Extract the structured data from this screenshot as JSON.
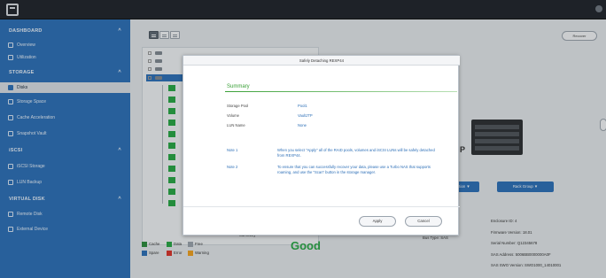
{
  "sidebar": {
    "sections": [
      {
        "label": "DASHBOARD",
        "chev": "^"
      },
      {
        "label": "STORAGE",
        "chev": "^"
      },
      {
        "label": "iSCSI",
        "chev": "^"
      },
      {
        "label": "VIRTUAL DISK",
        "chev": "^"
      }
    ],
    "items": [
      {
        "label": "Overview",
        "icon": "overview-icon"
      },
      {
        "label": "Utilization",
        "icon": "utilization-icon"
      },
      {
        "label": "Disks",
        "icon": "disk-icon"
      },
      {
        "label": "Storage Space",
        "icon": "storage-space-icon"
      },
      {
        "label": "Cache Acceleration",
        "icon": "cache-icon"
      },
      {
        "label": "Snapshot Vault",
        "icon": "snapshot-icon"
      },
      {
        "label": "iSCSI Storage",
        "icon": "iscsi-icon"
      },
      {
        "label": "LUN Backup",
        "icon": "backup-icon"
      },
      {
        "label": "Remote Disk",
        "icon": "remote-disk-icon"
      },
      {
        "label": "External Device",
        "icon": "external-device-icon"
      }
    ]
  },
  "toolbar": {
    "recover_label": "Recover"
  },
  "legend": [
    {
      "label": "Cache",
      "color": "#2d8b3c"
    },
    {
      "label": "Data",
      "color": "#28a745"
    },
    {
      "label": "Free",
      "color": "#9aa3ad"
    },
    {
      "label": "Spare",
      "color": "#2d6fb7"
    },
    {
      "label": "Error",
      "color": "#d9342b"
    },
    {
      "label": "Warning",
      "color": "#f0a020"
    }
  ],
  "status": {
    "summary_label": "Summary",
    "health": "Good",
    "bus_type": "Bus Type: SAS"
  },
  "actions": {
    "btn1": "Action ▼",
    "btn2": "Rack Group ▼"
  },
  "device_label": "P",
  "info": [
    "Enclosure ID: 4",
    "Firmware Version: 18.01",
    "Serial Number: Q12345678",
    "SAS Address: 5006BB0000000A0F",
    "SAS SWO Version: SWO1000_14010001"
  ],
  "modal": {
    "title": "Safely Detaching REXP44",
    "heading": "Summary",
    "rows": [
      {
        "key": "Storage Pool",
        "value": "Pool1"
      },
      {
        "key": "Volume",
        "value": "VaultJTP"
      },
      {
        "key": "LUN Name",
        "value": "None"
      }
    ],
    "notes": [
      {
        "key": "Note 1",
        "text": "When you select \"Apply\" all of the RAID pools, volumes and iSCSI LUNs will be safely detached from REXP44."
      },
      {
        "key": "Note 2",
        "text": "To ensure that you can successfully recover your data, please use a Turbo NAS that supports roaming, and use the \"Scan\" button in the storage manager."
      }
    ],
    "apply_label": "Apply",
    "cancel_label": "Cancel"
  }
}
